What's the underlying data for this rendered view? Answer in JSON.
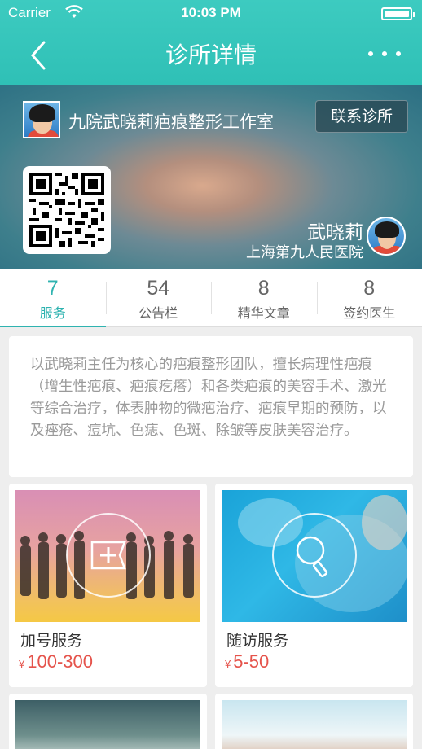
{
  "status": {
    "carrier": "Carrier",
    "time": "10:03 PM"
  },
  "nav": {
    "title": "诊所详情"
  },
  "hero": {
    "studio_name": "九院武晓莉疤痕整形工作室",
    "contact_label": "联系诊所",
    "doctor_name": "武晓莉",
    "hospital": "上海第九人民医院"
  },
  "tabs": [
    {
      "count": "7",
      "label": "服务"
    },
    {
      "count": "54",
      "label": "公告栏"
    },
    {
      "count": "8",
      "label": "精华文章"
    },
    {
      "count": "8",
      "label": "签约医生"
    }
  ],
  "active_tab": "服务",
  "description": "以武晓莉主任为核心的疤痕整形团队，擅长病理性疤痕（增生性疤痕、疤痕疙瘩）和各类疤痕的美容手术、激光等综合治疗，体表肿物的微疤治疗、疤痕早期的预防，以及痤疮、痘坑、色痣、色斑、除皱等皮肤美容治疗。",
  "services": [
    {
      "name": "加号服务",
      "currency": "¥",
      "price": "100-300",
      "icon": "plus-flag-icon"
    },
    {
      "name": "随访服务",
      "currency": "¥",
      "price": "5-50",
      "icon": "magnifier-icon"
    }
  ],
  "colors": {
    "accent": "#2fb3b0",
    "price": "#e5534b",
    "nav": "#3dcbc0"
  }
}
